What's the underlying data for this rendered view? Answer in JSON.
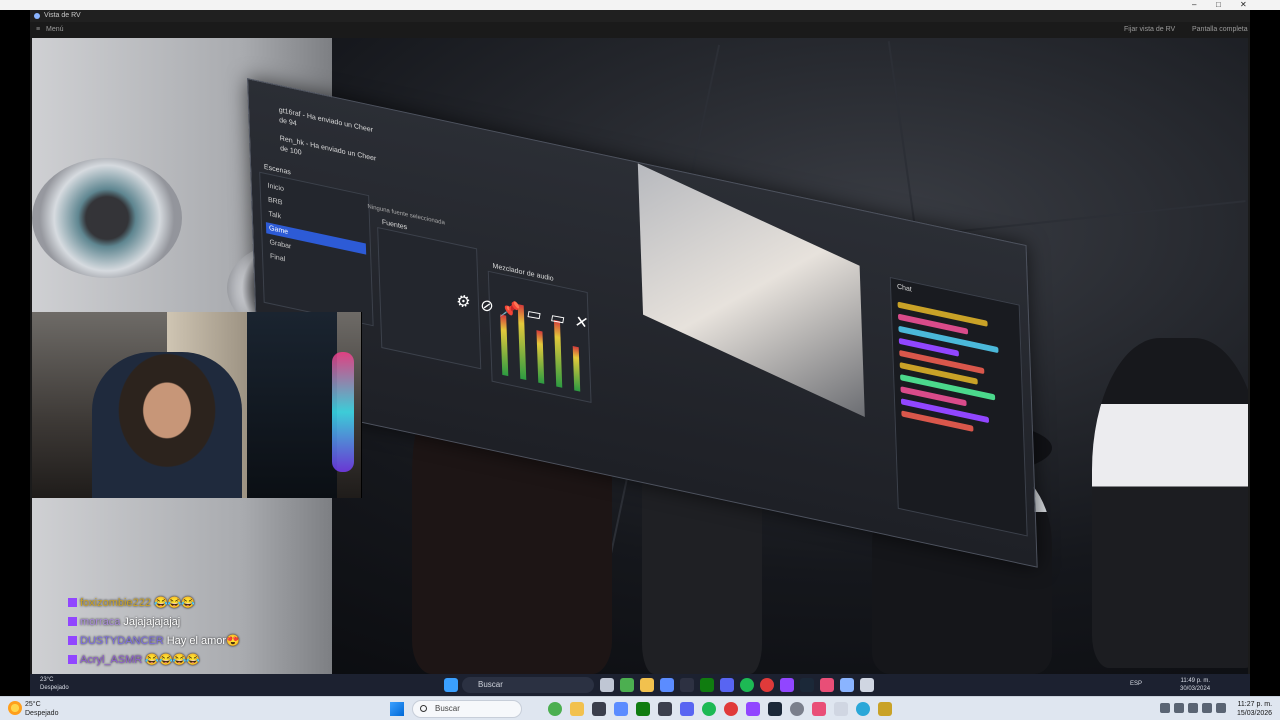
{
  "outer_window": {
    "controls": {
      "minimize": "–",
      "maximize": "□",
      "close": "✕"
    }
  },
  "app": {
    "title": "Vista de RV",
    "menu_label": "Menú",
    "pin_label": "Fijar vista de RV",
    "fullscreen_label": "Pantalla completa"
  },
  "obs": {
    "scenes_title": "Escenas",
    "scenes": [
      "Inicio",
      "BRB",
      "Talk",
      "Game",
      "Grabar",
      "Final"
    ],
    "active_scene": "Game",
    "sources_title": "Fuentes",
    "no_source": "Ninguna fuente seleccionada",
    "mixer_title": "Mezclador de audio",
    "chat_title": "Chat",
    "chat_alerts": [
      {
        "user": "gt16raf",
        "text": "Ha enviado un Cheer de 94"
      },
      {
        "user": "Ren_hk",
        "text": "Ha enviado un Cheer de 100"
      }
    ]
  },
  "vr_toolbar": {
    "icons": [
      "gear-icon",
      "disable-icon",
      "pin-icon",
      "window-icon",
      "window-icon",
      "close-icon"
    ]
  },
  "chat_overlay": [
    {
      "user": "foxizombie222",
      "message": "😂😂😂",
      "color": "#c9a227"
    },
    {
      "user": "morraca",
      "message": "Jajajajajajaj",
      "color": "#a88bd9"
    },
    {
      "user": "DUSTYDANCER",
      "message": "Hay el amor😍",
      "color": "#7d6ee0"
    },
    {
      "user": "Acryl_ASMR",
      "message": "😂😂😂😂",
      "color": "#8f5ecf"
    }
  ],
  "inner_taskbar": {
    "weather_temp": "23°C",
    "weather_desc": "Despejado",
    "search_placeholder": "Buscar",
    "language": "ESP",
    "time": "11:49 p. m.",
    "date": "30/03/2024"
  },
  "taskbar": {
    "weather_temp": "25°C",
    "weather_desc": "Despejado",
    "search_placeholder": "Buscar",
    "time": "11:27 p. m.",
    "date": "15/03/2026"
  }
}
